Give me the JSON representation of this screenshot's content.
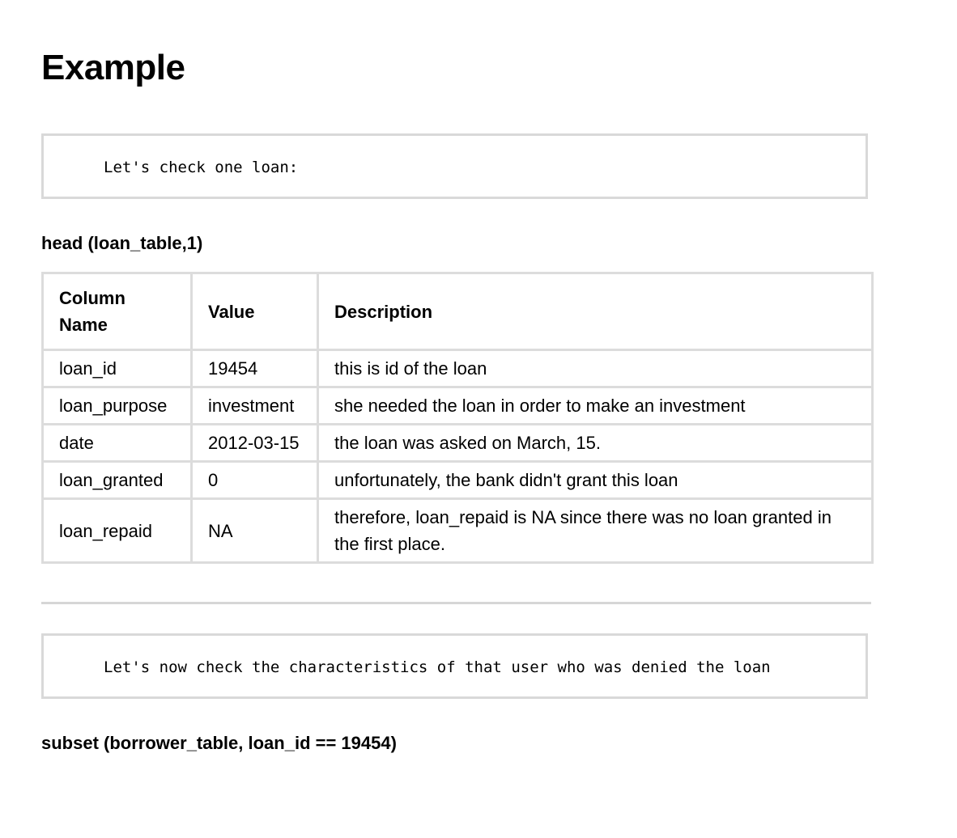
{
  "title": "Example",
  "blocks": {
    "first_code": "Let's check one loan:",
    "first_call": "head (loan_table,1)",
    "second_code": "Let's now check the characteristics of that user who was denied the loan",
    "second_call": "subset (borrower_table, loan_id == 19454)"
  },
  "table": {
    "headers": [
      "Column Name",
      "Value",
      "Description"
    ],
    "rows": [
      {
        "column": "loan_id",
        "value": "19454",
        "description": "this is id of the loan"
      },
      {
        "column": "loan_purpose",
        "value": "investment",
        "description": "she needed the loan in order to make an investment"
      },
      {
        "column": "date",
        "value": "2012-03-15",
        "description": "the loan was asked on March, 15."
      },
      {
        "column": "loan_granted",
        "value": "0",
        "description": "unfortunately, the bank didn't grant this loan"
      },
      {
        "column": "loan_repaid",
        "value": "NA",
        "description": "therefore, loan_repaid is NA since there was no loan granted in the first place."
      }
    ]
  }
}
